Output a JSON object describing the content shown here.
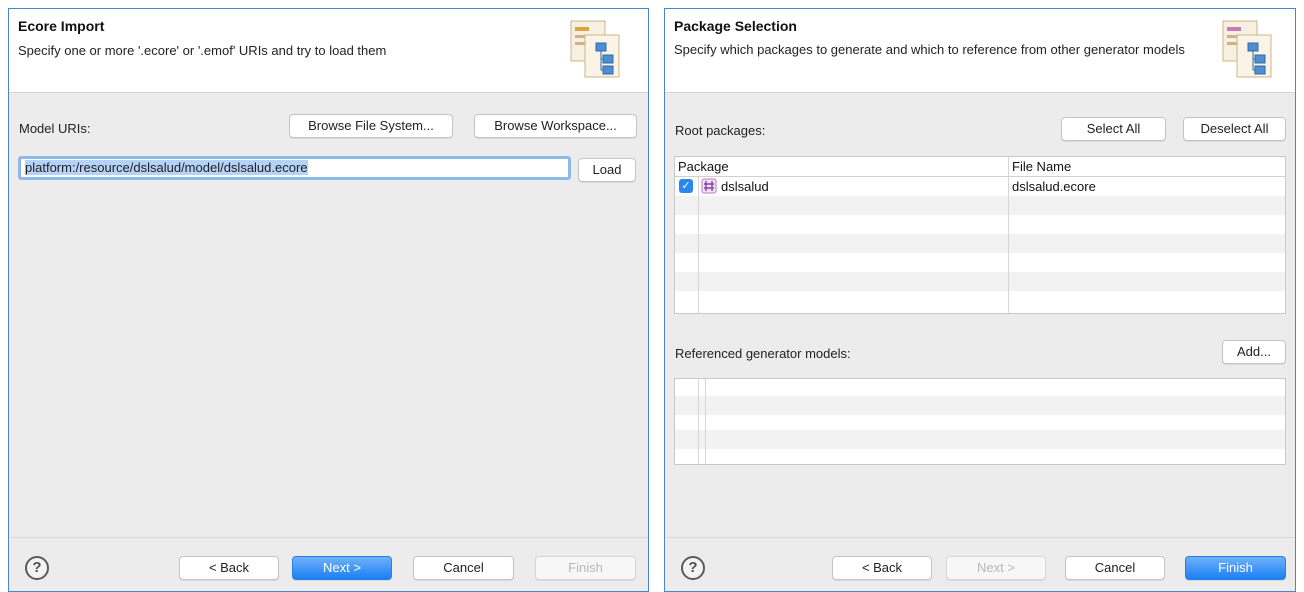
{
  "left_dialog": {
    "title": "Ecore Import",
    "description": "Specify one or more '.ecore' or '.emof' URIs and try to load them",
    "model_uris_label": "Model URIs:",
    "browse_file_system": "Browse File System...",
    "browse_workspace": "Browse Workspace...",
    "uri_value": "platform:/resource/dslsalud/model/dslsalud.ecore",
    "load": "Load",
    "footer": {
      "help": "?",
      "back": "< Back",
      "next": "Next >",
      "cancel": "Cancel",
      "finish": "Finish"
    }
  },
  "right_dialog": {
    "title": "Package Selection",
    "description": "Specify which packages to generate and which to reference from other generator models",
    "root_packages_label": "Root packages:",
    "select_all": "Select All",
    "deselect_all": "Deselect All",
    "columns": [
      "Package",
      "File Name"
    ],
    "packages": [
      {
        "checked": true,
        "name": "dslsalud",
        "file": "dslsalud.ecore"
      }
    ],
    "referenced_label": "Referenced generator models:",
    "add": "Add...",
    "footer": {
      "help": "?",
      "back": "< Back",
      "next": "Next >",
      "cancel": "Cancel",
      "finish": "Finish"
    }
  },
  "colors": {
    "accent": "#1a7ff5",
    "selection": "#b4d3f7",
    "border": "#4a86c5"
  }
}
